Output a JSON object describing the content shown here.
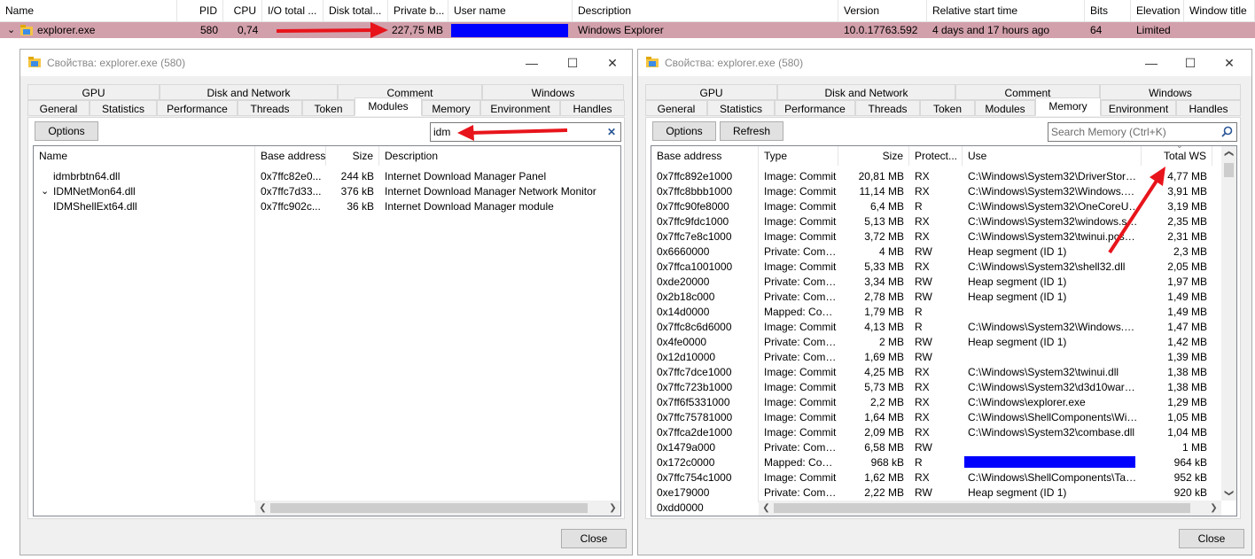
{
  "process_list": {
    "columns": [
      "Name",
      "PID",
      "CPU",
      "I/O total ...",
      "Disk total...",
      "Private b...",
      "User name",
      "Description",
      "Version",
      "Relative start time",
      "Bits",
      "Elevation",
      "Window title"
    ],
    "row": {
      "name": "explorer.exe",
      "pid": "580",
      "cpu": "0,74",
      "private_bytes": "227,75 MB",
      "user_name": "",
      "description": "Windows Explorer",
      "version": "10.0.17763.592",
      "relative_start_time": "4 days and 17 hours ago",
      "bits": "64",
      "elevation": "Limited"
    }
  },
  "left_window": {
    "title": "Свойства: explorer.exe (580)",
    "tabs_row1": [
      "GPU",
      "Disk and Network",
      "Comment",
      "Windows"
    ],
    "tabs_row2": [
      "General",
      "Statistics",
      "Performance",
      "Threads",
      "Token",
      "Modules",
      "Memory",
      "Environment",
      "Handles"
    ],
    "active_tab": "Modules",
    "options_label": "Options",
    "search_value": "idm",
    "columns": [
      "Name",
      "Base address",
      "Size",
      "Description"
    ],
    "rows": [
      {
        "name": "idmbrbtn64.dll",
        "base": "0x7ffc82e0...",
        "size": "244 kB",
        "desc": "Internet Download Manager Panel"
      },
      {
        "name": "IDMNetMon64.dll",
        "base": "0x7ffc7d33...",
        "size": "376 kB",
        "desc": "Internet Download Manager Network Monitor"
      },
      {
        "name": "IDMShellExt64.dll",
        "base": "0x7ffc902c...",
        "size": "36 kB",
        "desc": "Internet Download Manager module"
      }
    ],
    "close_label": "Close"
  },
  "right_window": {
    "title": "Свойства: explorer.exe (580)",
    "tabs_row1": [
      "GPU",
      "Disk and Network",
      "Comment",
      "Windows"
    ],
    "tabs_row2": [
      "General",
      "Statistics",
      "Performance",
      "Threads",
      "Token",
      "Modules",
      "Memory",
      "Environment",
      "Handles"
    ],
    "active_tab": "Memory",
    "options_label": "Options",
    "refresh_label": "Refresh",
    "search_placeholder": "Search Memory (Ctrl+K)",
    "columns": [
      "Base address",
      "Type",
      "Size",
      "Protect...",
      "Use",
      "Total WS"
    ],
    "rows": [
      [
        "0x7ffc892e1000",
        "Image: Commit",
        "20,81 MB",
        "RX",
        "C:\\Windows\\System32\\DriverStore\\...",
        "4,77 MB"
      ],
      [
        "0x7ffc8bbb1000",
        "Image: Commit",
        "11,14 MB",
        "RX",
        "C:\\Windows\\System32\\Windows.UI....",
        "3,91 MB"
      ],
      [
        "0x7ffc90fe8000",
        "Image: Commit",
        "6,4 MB",
        "R",
        "C:\\Windows\\System32\\OneCoreUAP...",
        "3,19 MB"
      ],
      [
        "0x7ffc9fdc1000",
        "Image: Commit",
        "5,13 MB",
        "RX",
        "C:\\Windows\\System32\\windows.sto...",
        "2,35 MB"
      ],
      [
        "0x7ffc7e8c1000",
        "Image: Commit",
        "3,72 MB",
        "RX",
        "C:\\Windows\\System32\\twinui.pcshel...",
        "2,31 MB"
      ],
      [
        "0x6660000",
        "Private: Commit",
        "4 MB",
        "RW",
        "Heap segment (ID 1)",
        "2,3 MB"
      ],
      [
        "0x7ffca1001000",
        "Image: Commit",
        "5,33 MB",
        "RX",
        "C:\\Windows\\System32\\shell32.dll",
        "2,05 MB"
      ],
      [
        "0xde20000",
        "Private: Commit",
        "3,34 MB",
        "RW",
        "Heap segment (ID 1)",
        "1,97 MB"
      ],
      [
        "0x2b18c000",
        "Private: Commit",
        "2,78 MB",
        "RW",
        "Heap segment (ID 1)",
        "1,49 MB"
      ],
      [
        "0x14d0000",
        "Mapped: Com...",
        "1,79 MB",
        "R",
        "",
        "1,49 MB"
      ],
      [
        "0x7ffc8c6d6000",
        "Image: Commit",
        "4,13 MB",
        "R",
        "C:\\Windows\\System32\\Windows.UI....",
        "1,47 MB"
      ],
      [
        "0x4fe0000",
        "Private: Commit",
        "2 MB",
        "RW",
        "Heap segment (ID 1)",
        "1,42 MB"
      ],
      [
        "0x12d10000",
        "Private: Commit",
        "1,69 MB",
        "RW",
        "",
        "1,39 MB"
      ],
      [
        "0x7ffc7dce1000",
        "Image: Commit",
        "4,25 MB",
        "RX",
        "C:\\Windows\\System32\\twinui.dll",
        "1,38 MB"
      ],
      [
        "0x7ffc723b1000",
        "Image: Commit",
        "5,73 MB",
        "RX",
        "C:\\Windows\\System32\\d3d10warp.dll",
        "1,38 MB"
      ],
      [
        "0x7ff6f5331000",
        "Image: Commit",
        "2,2 MB",
        "RX",
        "C:\\Windows\\explorer.exe",
        "1,29 MB"
      ],
      [
        "0x7ffc75781000",
        "Image: Commit",
        "1,64 MB",
        "RX",
        "C:\\Windows\\ShellComponents\\Wind...",
        "1,05 MB"
      ],
      [
        "0x7ffca2de1000",
        "Image: Commit",
        "2,09 MB",
        "RX",
        "C:\\Windows\\System32\\combase.dll",
        "1,04 MB"
      ],
      [
        "0x1479a000",
        "Private: Commit",
        "6,58 MB",
        "RW",
        "",
        "1 MB"
      ],
      [
        "0x172c0000",
        "Mapped: Com...",
        "968 kB",
        "R",
        "",
        "964 kB"
      ],
      [
        "0x7ffc754c1000",
        "Image: Commit",
        "1,62 MB",
        "RX",
        "C:\\Windows\\ShellComponents\\TaskF...",
        "952 kB"
      ],
      [
        "0xe179000",
        "Private: Commit",
        "2,22 MB",
        "RW",
        "Heap segment (ID 1)",
        "920 kB"
      ],
      [
        "0xdd0000",
        "",
        "",
        "",
        "",
        ""
      ]
    ],
    "close_label": "Close"
  },
  "colors": {
    "selected_row": "#d2a0ab",
    "redaction": "#0000ff",
    "arrow": "#e8141b"
  }
}
